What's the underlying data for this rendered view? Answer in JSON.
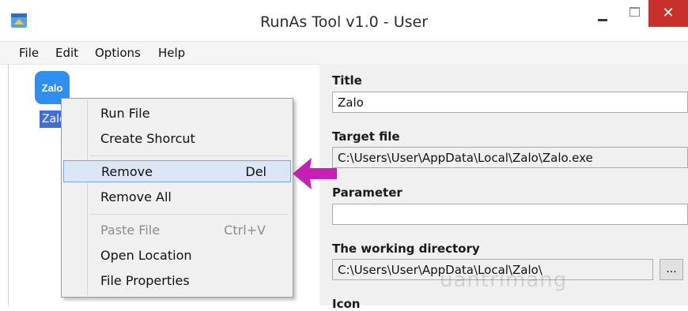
{
  "window": {
    "title": "RunAs Tool v1.0 - User",
    "close_symbol": "✕"
  },
  "menubar": {
    "items": [
      "File",
      "Edit",
      "Options",
      "Help"
    ]
  },
  "file_item": {
    "icon_text": "Zalo",
    "label": "Zalo"
  },
  "context_menu": {
    "run_file": "Run File",
    "create_shortcut": "Create Shorcut",
    "remove": "Remove",
    "remove_shortcut": "Del",
    "remove_all": "Remove All",
    "paste_file": "Paste File",
    "paste_shortcut": "Ctrl+V",
    "open_location": "Open Location",
    "file_properties": "File Properties"
  },
  "details": {
    "title_label": "Title",
    "title_value": "Zalo",
    "target_label": "Target file",
    "target_value": "C:\\Users\\User\\AppData\\Local\\Zalo\\Zalo.exe",
    "parameter_label": "Parameter",
    "parameter_value": "",
    "workdir_label": "The working directory",
    "workdir_value": "C:\\Users\\User\\AppData\\Local\\Zalo\\",
    "browse_label": "...",
    "icon_label": "Icon"
  },
  "watermark": "uantrimang",
  "colors": {
    "accent": "#3f6fd6",
    "arrow": "#c61fb5",
    "close": "#c7302b"
  }
}
